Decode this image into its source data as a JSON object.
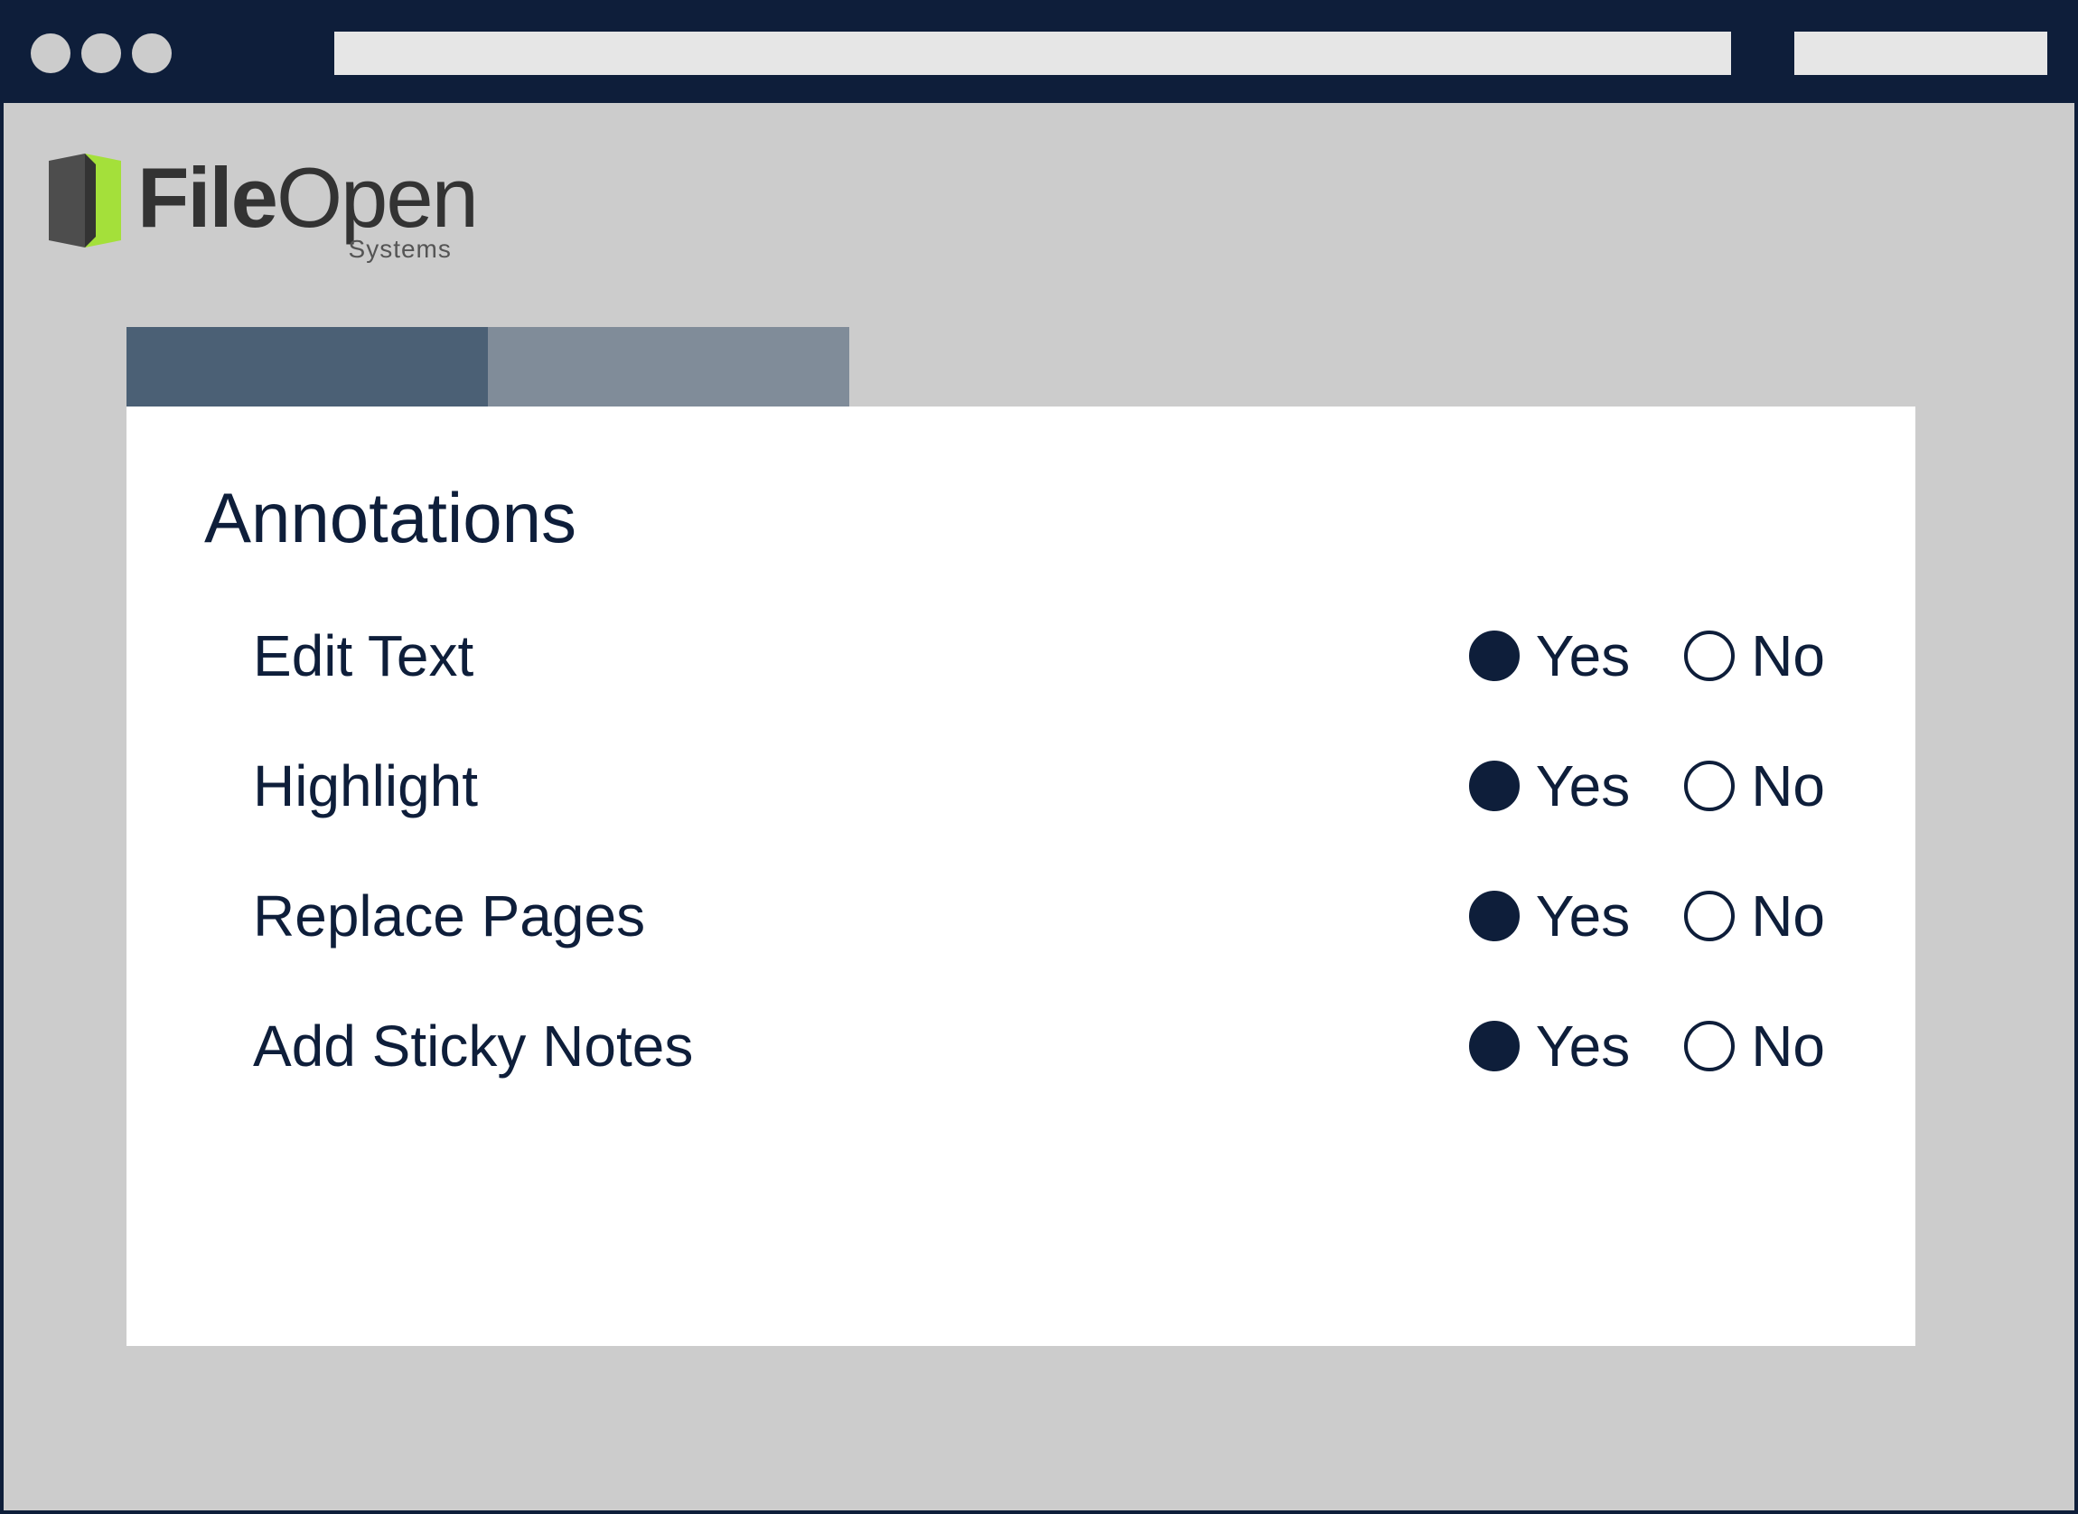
{
  "logo": {
    "bold_part": "File",
    "light_part": "Open",
    "subtitle": "Systems"
  },
  "card": {
    "title": "Annotations",
    "yes_label": "Yes",
    "no_label": "No",
    "options": [
      {
        "label": "Edit Text",
        "value": "yes"
      },
      {
        "label": "Highlight",
        "value": "yes"
      },
      {
        "label": "Replace Pages",
        "value": "yes"
      },
      {
        "label": "Add Sticky Notes",
        "value": "yes"
      }
    ]
  }
}
